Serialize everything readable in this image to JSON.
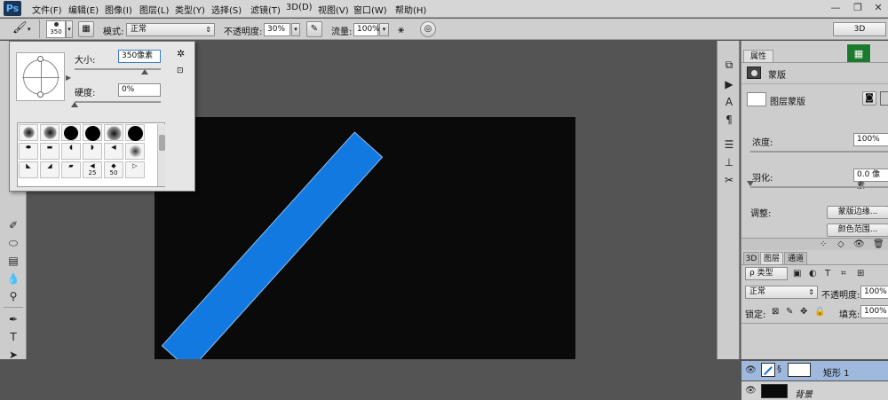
{
  "app": {
    "logo": "Ps"
  },
  "menu": {
    "items": [
      "文件(F)",
      "编辑(E)",
      "图像(I)",
      "图层(L)",
      "类型(Y)",
      "选择(S)",
      "滤镜(T)",
      "3D(D)",
      "视图(V)",
      "窗口(W)",
      "帮助(H)"
    ]
  },
  "window_controls": {
    "minimize": "—",
    "restore": "❐",
    "close": "✕"
  },
  "options_bar": {
    "brush_size": "350",
    "mode_label": "模式:",
    "mode_value": "正常",
    "opacity_label": "不透明度:",
    "opacity_value": "30%",
    "flow_label": "流量:",
    "flow_value": "100%",
    "workspace": "3D"
  },
  "brush_popup": {
    "size_label": "大小:",
    "size_value": "350像素",
    "hardness_label": "硬度:",
    "hardness_value": "0%",
    "preset_labels": [
      "25",
      "50"
    ]
  },
  "properties_panel": {
    "title": "属性",
    "mask_label": "蒙版",
    "layer_mask_label": "图层蒙版",
    "density_label": "浓度:",
    "density_value": "100%",
    "feather_label": "羽化:",
    "feather_value": "0.0 像素",
    "adjust_label": "调整:",
    "mask_edge_button": "蒙版边缘...",
    "color_range_button": "颜色范围..."
  },
  "layers_panel": {
    "tabs": [
      "3D",
      "图层",
      "通道"
    ],
    "filter_label": "ρ 类型",
    "blend_mode": "正常",
    "opacity_label": "不透明度:",
    "opacity_value": "100%",
    "lock_label": "锁定:",
    "fill_label": "填充:",
    "fill_value": "100%",
    "layers": [
      {
        "name": "矩形 1",
        "selected": true
      },
      {
        "name": "背景",
        "selected": false
      }
    ]
  },
  "colors": {
    "accent_blue": "#1279e0",
    "selected_layer": "#9fb8dd"
  }
}
